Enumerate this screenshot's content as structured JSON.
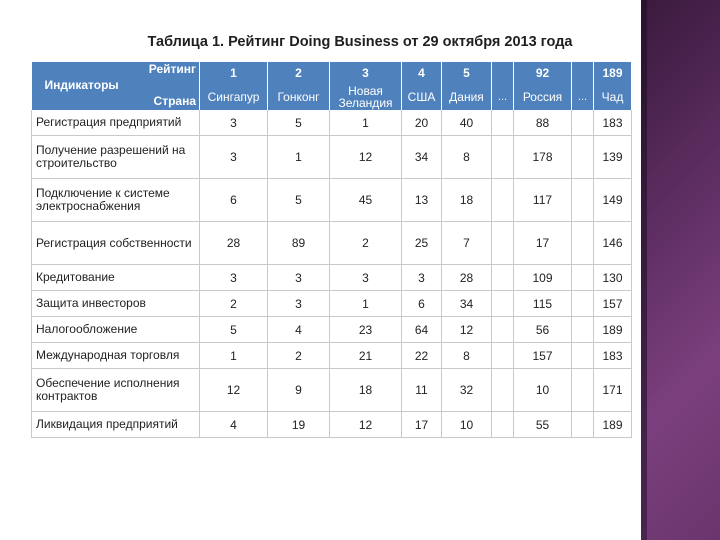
{
  "title": "Таблица 1. Рейтинг Doing Business от 29 октября 2013 года",
  "header": {
    "indicators_label": "Индикаторы",
    "rating_label": "Рейтинг",
    "country_label": "Страна",
    "ranks": [
      "1",
      "2",
      "3",
      "4",
      "5",
      "",
      "92",
      "",
      "189"
    ],
    "countries": [
      "Сингапур",
      "Гонконг",
      "Новая Зеландия",
      "США",
      "Дания",
      "...",
      "Россия",
      "...",
      "Чад"
    ]
  },
  "rows": [
    {
      "indicator": "Регистрация предприятий",
      "values": [
        "3",
        "5",
        "1",
        "20",
        "40",
        "",
        "88",
        "",
        "183"
      ]
    },
    {
      "indicator": "Получение разрешений на строительство",
      "values": [
        "3",
        "1",
        "12",
        "34",
        "8",
        "",
        "178",
        "",
        "139"
      ]
    },
    {
      "indicator": "Подключение к системе электроснабжения",
      "values": [
        "6",
        "5",
        "45",
        "13",
        "18",
        "",
        "117",
        "",
        "149"
      ]
    },
    {
      "indicator": "Регистрация собственности",
      "values": [
        "28",
        "89",
        "2",
        "25",
        "7",
        "",
        "17",
        "",
        "146"
      ]
    },
    {
      "indicator": "Кредитование",
      "values": [
        "3",
        "3",
        "3",
        "3",
        "28",
        "",
        "109",
        "",
        "130"
      ]
    },
    {
      "indicator": "Защита инвесторов",
      "values": [
        "2",
        "3",
        "1",
        "6",
        "34",
        "",
        "115",
        "",
        "157"
      ]
    },
    {
      "indicator": "Налогообложение",
      "values": [
        "5",
        "4",
        "23",
        "64",
        "12",
        "",
        "56",
        "",
        "189"
      ]
    },
    {
      "indicator": "Международная торговля",
      "values": [
        "1",
        "2",
        "21",
        "22",
        "8",
        "",
        "157",
        "",
        "183"
      ]
    },
    {
      "indicator": "Обеспечение исполнения контрактов",
      "values": [
        "12",
        "9",
        "18",
        "11",
        "32",
        "",
        "10",
        "",
        "171"
      ]
    },
    {
      "indicator": "Ликвидация предприятий",
      "values": [
        "4",
        "19",
        "12",
        "17",
        "10",
        "",
        "55",
        "",
        "189"
      ]
    }
  ],
  "colors": {
    "header_bg": "#4f81bd",
    "sidebar_accent": "#6a356d"
  }
}
